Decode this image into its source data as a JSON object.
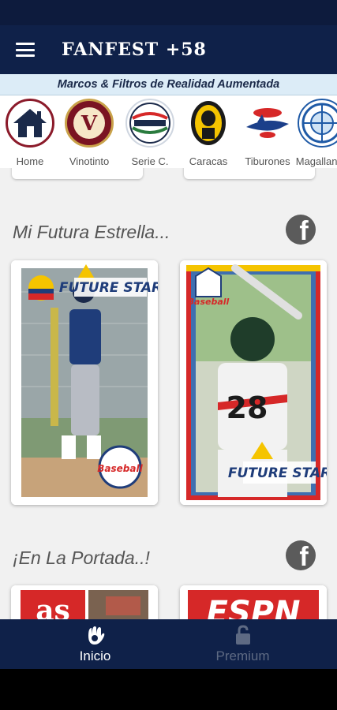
{
  "app": {
    "title": "FANFEST +58"
  },
  "banner": {
    "text": "Marcos & Filtros de Realidad Aumentada"
  },
  "categories": [
    {
      "label": "Home",
      "icon": "home-icon"
    },
    {
      "label": "Vinotinto",
      "icon": "vinotinto-logo"
    },
    {
      "label": "Serie C.",
      "icon": "serie-del-caribe-logo"
    },
    {
      "label": "Caracas",
      "icon": "caracas-leones-logo"
    },
    {
      "label": "Tiburones",
      "icon": "tiburones-logo"
    },
    {
      "label": "Magallanes",
      "icon": "magallanes-logo"
    }
  ],
  "sections": [
    {
      "title": "Mi Futura Estrella..."
    },
    {
      "title": "¡En La Portada..!"
    }
  ],
  "cards": {
    "star_left": {
      "badge": "FUTURE STAR",
      "sticker": "Baseball"
    },
    "star_right": {
      "badge": "FUTURE STAR",
      "sticker": "Baseball",
      "jersey_number": "28"
    },
    "as_logo": "as",
    "espn_logo": "ESPN"
  },
  "bottom_nav": [
    {
      "label": "Inicio",
      "active": true
    },
    {
      "label": "Premium",
      "active": false
    }
  ],
  "colors": {
    "primary": "#0f2149",
    "accent_red": "#d62828",
    "accent_yellow": "#f5c400"
  }
}
